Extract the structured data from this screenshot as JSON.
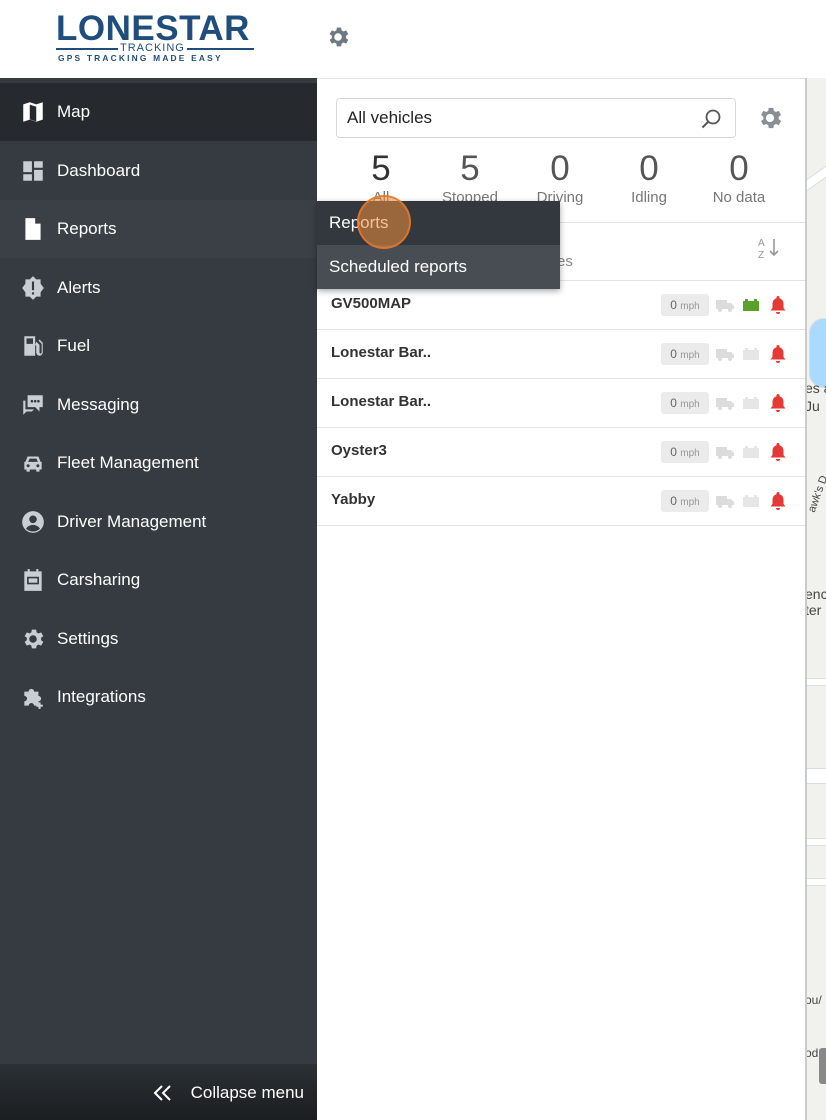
{
  "header": {
    "logo_main": "LONESTAR",
    "logo_sub": "TRACKING",
    "logo_tagline": "GPS TRACKING MADE EASY",
    "settings_icon": "gear-icon"
  },
  "sidebar": {
    "items": [
      {
        "label": "Map",
        "icon": "map-icon"
      },
      {
        "label": "Dashboard",
        "icon": "dashboard-icon"
      },
      {
        "label": "Reports",
        "icon": "document-icon"
      },
      {
        "label": "Alerts",
        "icon": "alert-badge-icon"
      },
      {
        "label": "Fuel",
        "icon": "fuel-pump-icon"
      },
      {
        "label": "Messaging",
        "icon": "chat-icon"
      },
      {
        "label": "Fleet Management",
        "icon": "car-icon"
      },
      {
        "label": "Driver Management",
        "icon": "user-icon"
      },
      {
        "label": "Carsharing",
        "icon": "calendar-icon"
      },
      {
        "label": "Settings",
        "icon": "gear-icon"
      },
      {
        "label": "Integrations",
        "icon": "puzzle-icon"
      }
    ],
    "active_item": "Map",
    "collapse_label": "Collapse menu"
  },
  "vehicles": {
    "search_value": "All vehicles",
    "stats": [
      {
        "count": "5",
        "label": "All"
      },
      {
        "count": "5",
        "label": "Stopped"
      },
      {
        "count": "0",
        "label": "Driving"
      },
      {
        "count": "0",
        "label": "Idling"
      },
      {
        "count": "0",
        "label": "No data"
      }
    ],
    "list_header_fragment": "es",
    "rows": [
      {
        "name": "GV500MAP",
        "speed": "0",
        "unit": "mph",
        "battery_color": "#5aa02c"
      },
      {
        "name": "Lonestar Bar..",
        "speed": "0",
        "unit": "mph",
        "battery_color": "#e6e6e6"
      },
      {
        "name": "Lonestar Bar..",
        "speed": "0",
        "unit": "mph",
        "battery_color": "#e6e6e6"
      },
      {
        "name": "Oyster3",
        "speed": "0",
        "unit": "mph",
        "battery_color": "#e6e6e6"
      },
      {
        "name": "Yabby",
        "speed": "0",
        "unit": "mph",
        "battery_color": "#e6e6e6"
      }
    ]
  },
  "reports_flyout": {
    "items": [
      {
        "label": "Reports"
      },
      {
        "label": "Scheduled reports"
      }
    ]
  },
  "map_labels": [
    "es a",
    "Ju",
    "awk's D",
    "enc",
    "ter",
    "ou/",
    "od"
  ],
  "colors": {
    "sidebar_bg": "#353b41",
    "sidebar_active": "#262a2e",
    "logo_blue": "#1f4e7d",
    "alert_red": "#e53935",
    "battery_green": "#5aa02c"
  }
}
